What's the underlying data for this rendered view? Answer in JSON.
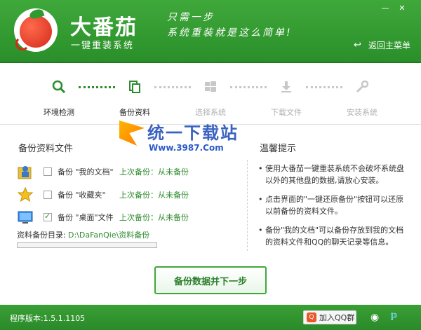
{
  "app": {
    "title": "大番茄",
    "subtitle": "一键重装系统",
    "slogan_line1": "只需一步",
    "slogan_line2": "系统重装就是这么简单!",
    "back_home": "返回主菜单",
    "window_minimize": "—",
    "window_close": "✕"
  },
  "steps": [
    {
      "label": "环境检测",
      "icon": "search-icon",
      "state": "done"
    },
    {
      "label": "备份资料",
      "icon": "copy-icon",
      "state": "active"
    },
    {
      "label": "选择系统",
      "icon": "windows-icon",
      "state": "pending"
    },
    {
      "label": "下载文件",
      "icon": "download-icon",
      "state": "pending"
    },
    {
      "label": "安装系统",
      "icon": "wrench-icon",
      "state": "pending"
    }
  ],
  "backup": {
    "section_title": "备份资料文件",
    "items": [
      {
        "name": "备份 \"我的文档\"",
        "status": "上次备份：从未备份",
        "checked": false,
        "icon": "user-folder-icon"
      },
      {
        "name": "备份 \"收藏夹\"",
        "status": "上次备份：从未备份",
        "checked": false,
        "icon": "star-icon"
      },
      {
        "name": "备份 \"桌面\"文件",
        "status": "上次备份：从未备份",
        "checked": true,
        "icon": "desktop-icon"
      }
    ],
    "dir_label": "资料备份目录:",
    "dir_path": "D:\\DaFanQie\\资料备份",
    "progress": 0
  },
  "tips": {
    "title": "温馨提示",
    "items": [
      "使用大番茄一键重装系统不会破坏系统盘以外的其他盘的数据,请放心安装。",
      "点击界面的\"一键还原备份\"按钮可以还原以前备份的资料文件。",
      "备份\"我的文档\"可以备份存放到我的文档的资料文件和QQ的聊天记录等信息。"
    ]
  },
  "watermark": {
    "line1": "统一下载站",
    "line2": "Www.3987.Com"
  },
  "primary_button": "备份数据并下一步",
  "footer": {
    "version": "程序版本:1.5.1.1105",
    "qq_group": "加入QQ群",
    "qq_badge": "Q"
  },
  "colors": {
    "brand_green": "#3fa83a",
    "status_green": "#2e8b2e"
  }
}
